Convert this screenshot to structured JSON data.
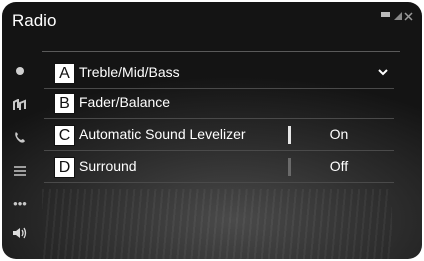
{
  "header": {
    "title": "Radio"
  },
  "sidebar": {
    "icons": [
      "radio-icon",
      "media-icon",
      "phone-icon",
      "list-icon",
      "more-icon",
      "volume-icon"
    ],
    "more_label": "•••"
  },
  "menu": {
    "items": [
      {
        "marker": "A",
        "label": "Treble/Mid/Bass",
        "value": "",
        "expandable": true
      },
      {
        "marker": "B",
        "label": "Fader/Balance",
        "value": ""
      },
      {
        "marker": "C",
        "label": "Automatic Sound Levelizer",
        "value": "On"
      },
      {
        "marker": "D",
        "label": "Surround",
        "value": "Off"
      }
    ]
  },
  "colors": {
    "background": "#161616",
    "text": "#ffffff",
    "divider_active": "#e6e6e6",
    "divider_inactive": "#6a6a6a"
  }
}
